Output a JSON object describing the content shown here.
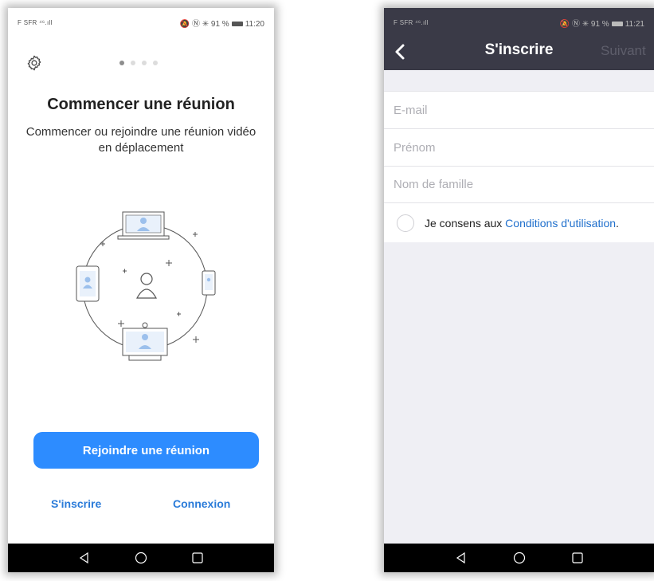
{
  "screen1": {
    "status": {
      "carrier": "F SFR ⁴⁶.ıll",
      "indicators": "🔕 Ⓝ ✳ 91 %",
      "time": "11:20"
    },
    "pager": {
      "count": 4,
      "active": 1
    },
    "title": "Commencer une réunion",
    "subtitle": "Commencer ou rejoindre une réunion vidéo en déplacement",
    "join_button": "Rejoindre une réunion",
    "signup_link": "S'inscrire",
    "login_link": "Connexion"
  },
  "screen2": {
    "status": {
      "carrier": "F SFR ⁴⁶.ıll",
      "indicators": "🔕 Ⓝ ✳ 91 %",
      "time": "11:21"
    },
    "title": "S'inscrire",
    "next_button": "Suivant",
    "fields": [
      {
        "placeholder": "E-mail"
      },
      {
        "placeholder": "Prénom"
      },
      {
        "placeholder": "Nom de famille"
      }
    ],
    "consent_prefix": "Je consens aux ",
    "consent_link": "Conditions d'utilisation",
    "consent_suffix": "."
  },
  "colors": {
    "primary_blue": "#2d8cff",
    "link_blue": "#2a7bd9",
    "header_dark": "#3a3a47",
    "form_background": "#efeff4"
  },
  "icons": [
    "settings-gear-icon",
    "back-chevron-icon",
    "nav-back-icon",
    "nav-home-icon",
    "nav-recents-icon"
  ]
}
